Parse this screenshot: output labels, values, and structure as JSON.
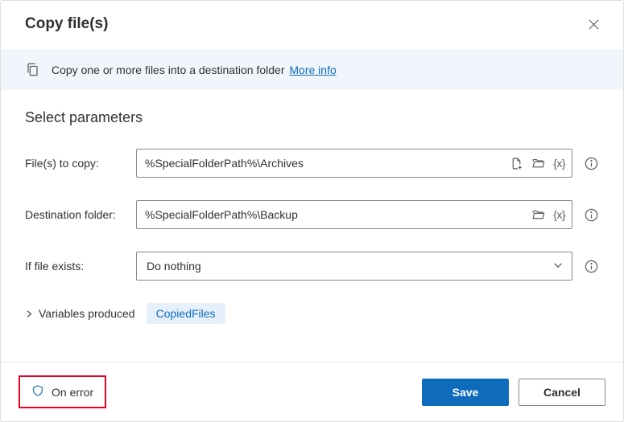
{
  "dialog": {
    "title": "Copy file(s)"
  },
  "banner": {
    "text": "Copy one or more files into a destination folder",
    "link": "More info"
  },
  "section": {
    "title": "Select parameters"
  },
  "form": {
    "files": {
      "label": "File(s) to copy:",
      "value": "%SpecialFolderPath%\\Archives"
    },
    "dest": {
      "label": "Destination folder:",
      "value": "%SpecialFolderPath%\\Backup"
    },
    "exists": {
      "label": "If file exists:",
      "value": "Do nothing"
    }
  },
  "variables": {
    "label": "Variables produced",
    "chip": "CopiedFiles"
  },
  "footer": {
    "on_error": "On error",
    "save": "Save",
    "cancel": "Cancel"
  },
  "icons": {
    "var_token": "{x}"
  }
}
